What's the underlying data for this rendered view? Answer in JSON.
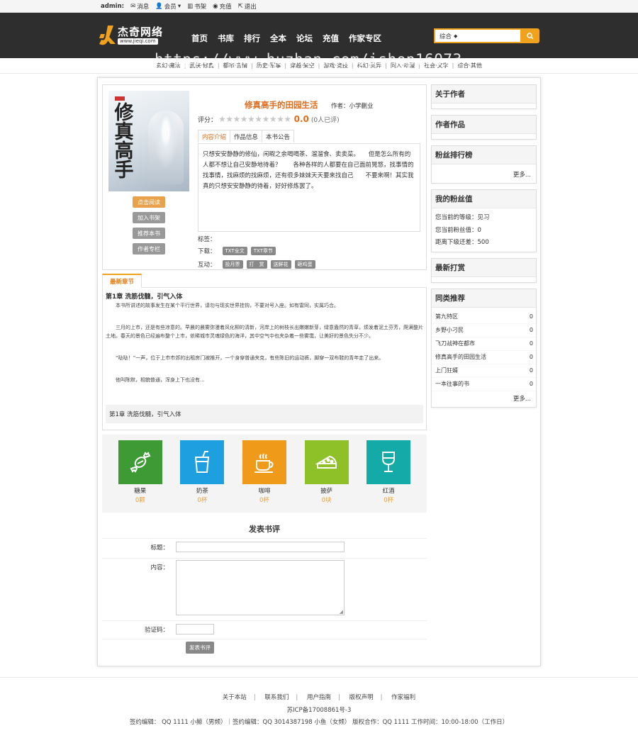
{
  "topbar": {
    "user": "admin",
    "message": "消息",
    "member": "会员",
    "bookshelf": "书架",
    "recharge": "充值",
    "logout": "退出"
  },
  "logo": {
    "name": "杰奇网络",
    "domain": "www.jieqi.com"
  },
  "nav": [
    "首页",
    "书库",
    "排行",
    "全本",
    "论坛",
    "充值",
    "作家专区"
  ],
  "search": {
    "scope": "综合"
  },
  "watermark": "https://www.huzhan.com/ishop16073",
  "categories": [
    "玄幻·魔法",
    "武侠·修真",
    "都市·言情",
    "历史·军事",
    "穿越·架空",
    "游戏·竞技",
    "科幻·灵异",
    "同人·动漫",
    "社会·文学",
    "综合·其他"
  ],
  "book": {
    "cover_title": "修真高手",
    "title": "修真高手的田园生活",
    "author_label": "作者：",
    "author": "小学蒯业",
    "rating_label": "评分：",
    "score": "0.0",
    "rating_count": "(0人已评)",
    "tabs": [
      "内容介绍",
      "作品信息",
      "本书公告"
    ],
    "intro": "只想安安静静的修仙，闲暇之余喝喝茶、溜溜食、卖卖菜。　　但是怎么所有的人都不想让自己安静地待着？　　各种各样的人都要在自己面前晃悠，找事情的找事情，找麻烦的找麻烦，还有很多妹妹天天要来找自己　　不要来啊！其实我真的只想安安静静的待着，好好修炼罢了。",
    "buttons": {
      "read": "点击阅读",
      "shelf": "加入书架",
      "recommend": "推荐本书",
      "column": "作者专栏"
    },
    "tags_label": "标签：",
    "download_label": "下载：",
    "downloads": [
      "TXT全文",
      "TXT章节"
    ],
    "interact_label": "互动：",
    "interactions": [
      "投月票",
      "打　赏",
      "送鲜花",
      "砸鸡蛋"
    ]
  },
  "chapter": {
    "tab": "最新章节",
    "title": "第1章 洗筋伐髓，引气入体",
    "p1": "本书所讲述的故事发生在某个平行世界，请勿与现实世界挂钩，不要对号入座。如有雷同，实属巧合。",
    "p2": "三月的上市，还是有些凉意的。早晨的晨雾弥漫着风化柳的清新，河岸上的树枝长出嫩嫩新芽，绿意盎然的青草，烦发着泥土芬芳，爬满整片土地。春天的景色已经遍布整个上市，依稀城市灵魂绿色的海洋，其中空气中也夹杂着一些雾霭，让美好的景色失分不少。",
    "p3": "“哒哒！”一声，位于上市市郊的出租房门被推开，一个身穿普通夹克，有些陈旧的运动裤，脚穿一双布鞋的青年走了出来。",
    "p4": "他叫陈默，相貌普通，浑身上下也没有...",
    "footer": "第1章 洗筋伐髓，引气入体"
  },
  "gifts": [
    {
      "name": "糖果",
      "count": "0颗",
      "color": "#3e9a35",
      "icon": "candy-icon"
    },
    {
      "name": "奶茶",
      "count": "0杯",
      "color": "#1e9fe0",
      "icon": "milk-tea-icon"
    },
    {
      "name": "咖啡",
      "count": "0杯",
      "color": "#f09a1a",
      "icon": "coffee-icon"
    },
    {
      "name": "披萨",
      "count": "0块",
      "color": "#8dc127",
      "icon": "pizza-icon"
    },
    {
      "name": "红酒",
      "count": "0杯",
      "color": "#14aaa7",
      "icon": "wine-icon"
    }
  ],
  "review": {
    "heading": "发表书评",
    "title_label": "标题：",
    "content_label": "内容：",
    "captcha_label": "验证码：",
    "submit": "发表书评"
  },
  "sidebar": {
    "about_author": "关于作者",
    "author_works": "作者作品",
    "fan_rank": "粉丝排行榜",
    "more": "更多...",
    "my_fans": "我的粉丝值",
    "level_label": "您当前的等级：",
    "level": "见习",
    "fans_label": "您当前粉丝值：",
    "fans": "0",
    "next_label": "距离下级还差：",
    "next": "500",
    "latest_tips": "最新打赏",
    "similar": "同类推荐",
    "recs": [
      {
        "title": "第九特区",
        "count": "0"
      },
      {
        "title": "乡野小刁民",
        "count": "0"
      },
      {
        "title": "飞刀战神在都市",
        "count": "0"
      },
      {
        "title": "修真高手的田园生活",
        "count": "0"
      },
      {
        "title": "上门狂婿",
        "count": "0"
      },
      {
        "title": "一本往事的书",
        "count": "0"
      }
    ]
  },
  "footer": {
    "links": [
      "关于本站",
      "联系我们",
      "用户指南",
      "版权声明",
      "作家福利"
    ],
    "icp": "苏ICP备17008861号-3",
    "contact": "签约编辑：  QQ 1111 小鲸（男频）｜签约编辑：QQ 3014387198 小鱼（女频）  版权合作：QQ 1111 工作时间：10:00-18:00（工作日）"
  }
}
